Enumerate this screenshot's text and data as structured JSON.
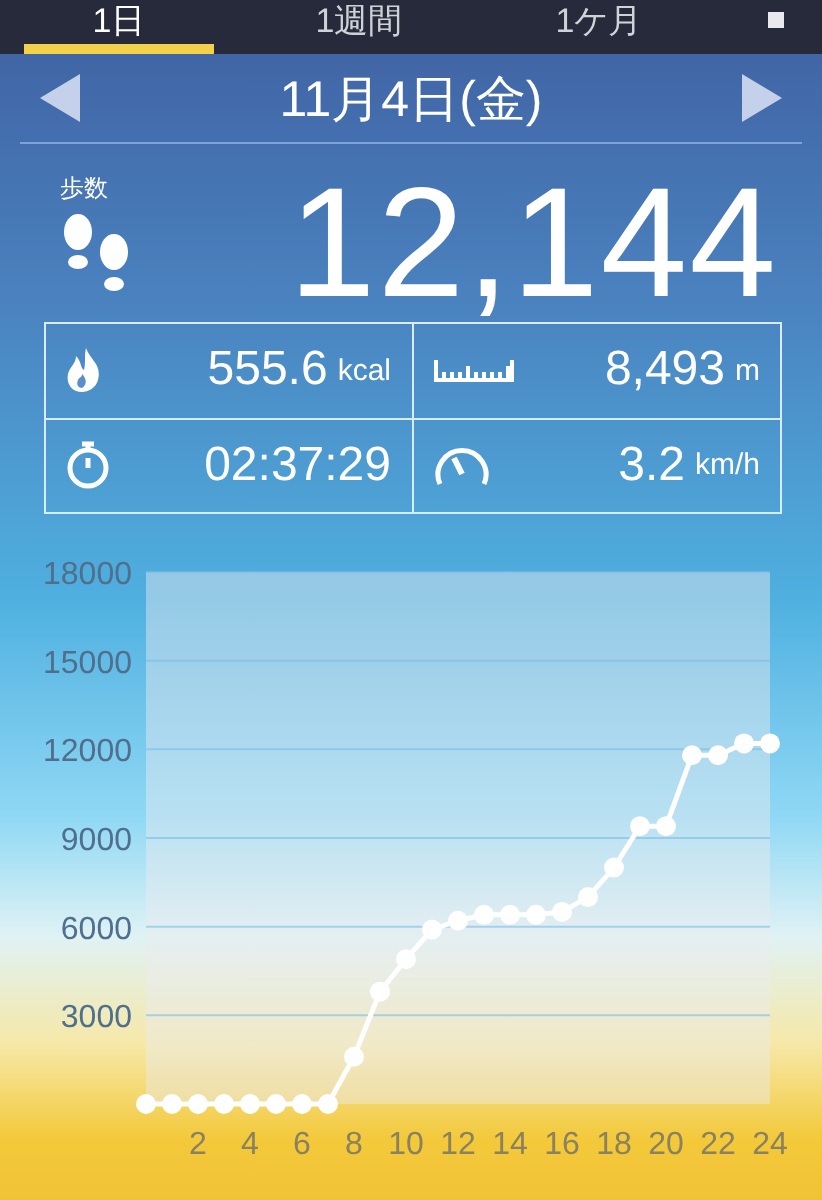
{
  "tabs": [
    {
      "label": "1日",
      "selected": true
    },
    {
      "label": "1週間",
      "selected": false
    },
    {
      "label": "1ケ月",
      "selected": false
    }
  ],
  "date": {
    "label": "11月4日(金)"
  },
  "steps": {
    "label": "歩数",
    "value": "12,144"
  },
  "stats": [
    {
      "kind": "calories",
      "value": "555.6",
      "unit": "kcal"
    },
    {
      "kind": "distance",
      "value": "8,493",
      "unit": "m"
    },
    {
      "kind": "time",
      "value": "02:37:29"
    },
    {
      "kind": "speed",
      "value": "3.2",
      "unit": "km/h"
    }
  ],
  "chart": {
    "chart_data": {
      "type": "line",
      "x": [
        0,
        1,
        2,
        3,
        4,
        5,
        6,
        7,
        8,
        9,
        10,
        11,
        12,
        13,
        14,
        15,
        16,
        17,
        18,
        19,
        20,
        21,
        22,
        23,
        24
      ],
      "grid": true,
      "series": [
        {
          "color": "#ffffff",
          "marker": true,
          "values": [
            0,
            0,
            0,
            0,
            0,
            0,
            0,
            0,
            1600,
            3800,
            4900,
            5900,
            6200,
            6400,
            6400,
            6400,
            6500,
            7000,
            8000,
            9400,
            9400,
            11800,
            11800,
            12200,
            12200
          ]
        }
      ],
      "xlim": [
        0,
        24
      ],
      "ylim": [
        0,
        18000
      ],
      "xticks": [
        2,
        4,
        6,
        8,
        10,
        12,
        14,
        16,
        18,
        20,
        22,
        24
      ],
      "yticks": [
        3000,
        6000,
        9000,
        12000,
        15000,
        18000
      ]
    }
  }
}
